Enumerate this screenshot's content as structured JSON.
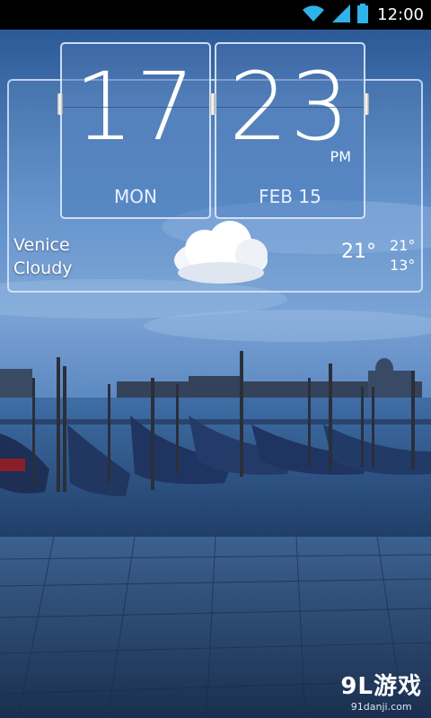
{
  "status_bar": {
    "time": "12:00"
  },
  "clock": {
    "hours": "17",
    "minutes": "23",
    "ampm": "PM",
    "day": "MON",
    "date": "FEB 15"
  },
  "weather": {
    "city": "Venice",
    "condition": "Cloudy",
    "current_temp": "21°",
    "high": "21°",
    "low": "13°",
    "icon": "cloud-icon"
  },
  "watermark": {
    "logo": "9L游戏",
    "url": "91danji.com"
  },
  "colors": {
    "sky_top": "#2f5d99",
    "sky_mid": "#6e9ad0",
    "water": "#2c4e7a",
    "pavement": "#26446a"
  }
}
